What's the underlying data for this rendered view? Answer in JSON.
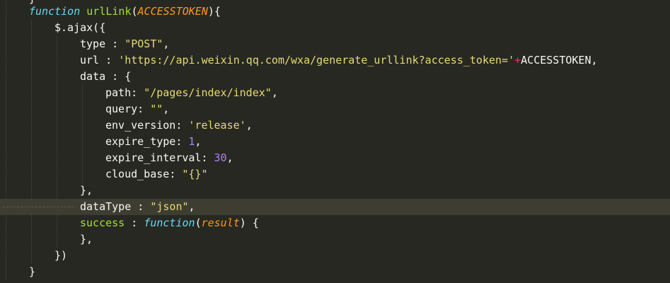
{
  "editor": {
    "theme_colors": {
      "background": "#272822",
      "active_line": "#3e3d32",
      "keyword": "#66d9ef",
      "function_name": "#a6e22e",
      "parameter": "#fd971f",
      "string": "#e6db74",
      "number": "#ae81ff",
      "operator": "#f92672",
      "text": "#f8f8f2"
    },
    "lines": {
      "l0": "}",
      "l1": {
        "keyword": "function",
        "name": "urlLink",
        "open": "(",
        "param": "ACCESSTOKEN",
        "close": "){"
      },
      "l2": {
        "text": "$.ajax({"
      },
      "l3": {
        "key": "type",
        "sep": " : ",
        "value": "\"POST\"",
        "end": ","
      },
      "l4": {
        "key": "url",
        "sep": " : ",
        "value": "'https://api.weixin.qq.com/wxa/generate_urllink?access_token='",
        "op": "+",
        "var": "ACCESSTOKEN",
        "end": ","
      },
      "l5": {
        "key": "data",
        "sep": " : ",
        "end": "{"
      },
      "l6": {
        "key": "path",
        "sep": ": ",
        "value": "\"/pages/index/index\"",
        "end": ","
      },
      "l7": {
        "key": "query",
        "sep": ": ",
        "value": "\"\"",
        "end": ","
      },
      "l8": {
        "key": "env_version",
        "sep": ": ",
        "value": "'release'",
        "end": ","
      },
      "l9": {
        "key": "expire_type",
        "sep": ": ",
        "value": "1",
        "end": ","
      },
      "l10": {
        "key": "expire_interval",
        "sep": ": ",
        "value": "30",
        "end": ","
      },
      "l11": {
        "key": "cloud_base",
        "sep": ": ",
        "value": "\"{}\""
      },
      "l12": {
        "text": "},"
      },
      "l13": {
        "key": "dataType",
        "sep": " : ",
        "value": "\"json\"",
        "end": ","
      },
      "l14": {
        "key": "success",
        "sep": " : ",
        "keyword": "function",
        "open": "(",
        "param": "result",
        "close": ") {"
      },
      "l15": {
        "text": "},"
      },
      "l16": {
        "text": "})"
      },
      "l17": {
        "text": "}"
      }
    }
  }
}
